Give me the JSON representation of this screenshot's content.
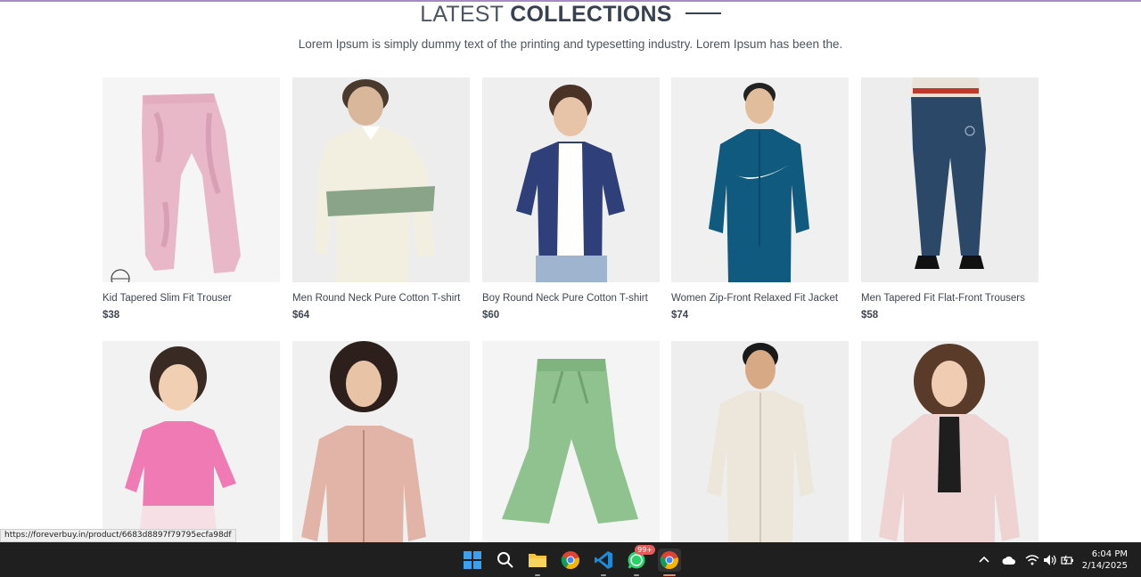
{
  "section": {
    "title_light": "LATEST",
    "title_bold": "COLLECTIONS",
    "subtitle": "Lorem Ipsum is simply dummy text of the printing and typesetting industry. Lorem Ipsum has been the."
  },
  "products": [
    {
      "name": "Kid Tapered Slim Fit Trouser",
      "price": "$38"
    },
    {
      "name": "Men Round Neck Pure Cotton T-shirt",
      "price": "$64"
    },
    {
      "name": "Boy Round Neck Pure Cotton T-shirt",
      "price": "$60"
    },
    {
      "name": "Women Zip-Front Relaxed Fit Jacket",
      "price": "$74"
    },
    {
      "name": "Men Tapered Fit Flat-Front Trousers",
      "price": "$58"
    },
    {
      "name": "",
      "price": ""
    },
    {
      "name": "",
      "price": ""
    },
    {
      "name": "",
      "price": ""
    },
    {
      "name": "",
      "price": ""
    },
    {
      "name": "",
      "price": ""
    }
  ],
  "status_bar": {
    "url": "https://foreverbuy.in/product/6683d8897f79795ecfa98df"
  },
  "taskbar": {
    "whatsapp_badge": "99+",
    "time": "6:04 PM",
    "date": "2/14/2025"
  },
  "colors": {
    "taskbar_bg": "#1f1f1f",
    "card_bg": "#f1f1f3",
    "accent_line": "#a78bc9"
  }
}
